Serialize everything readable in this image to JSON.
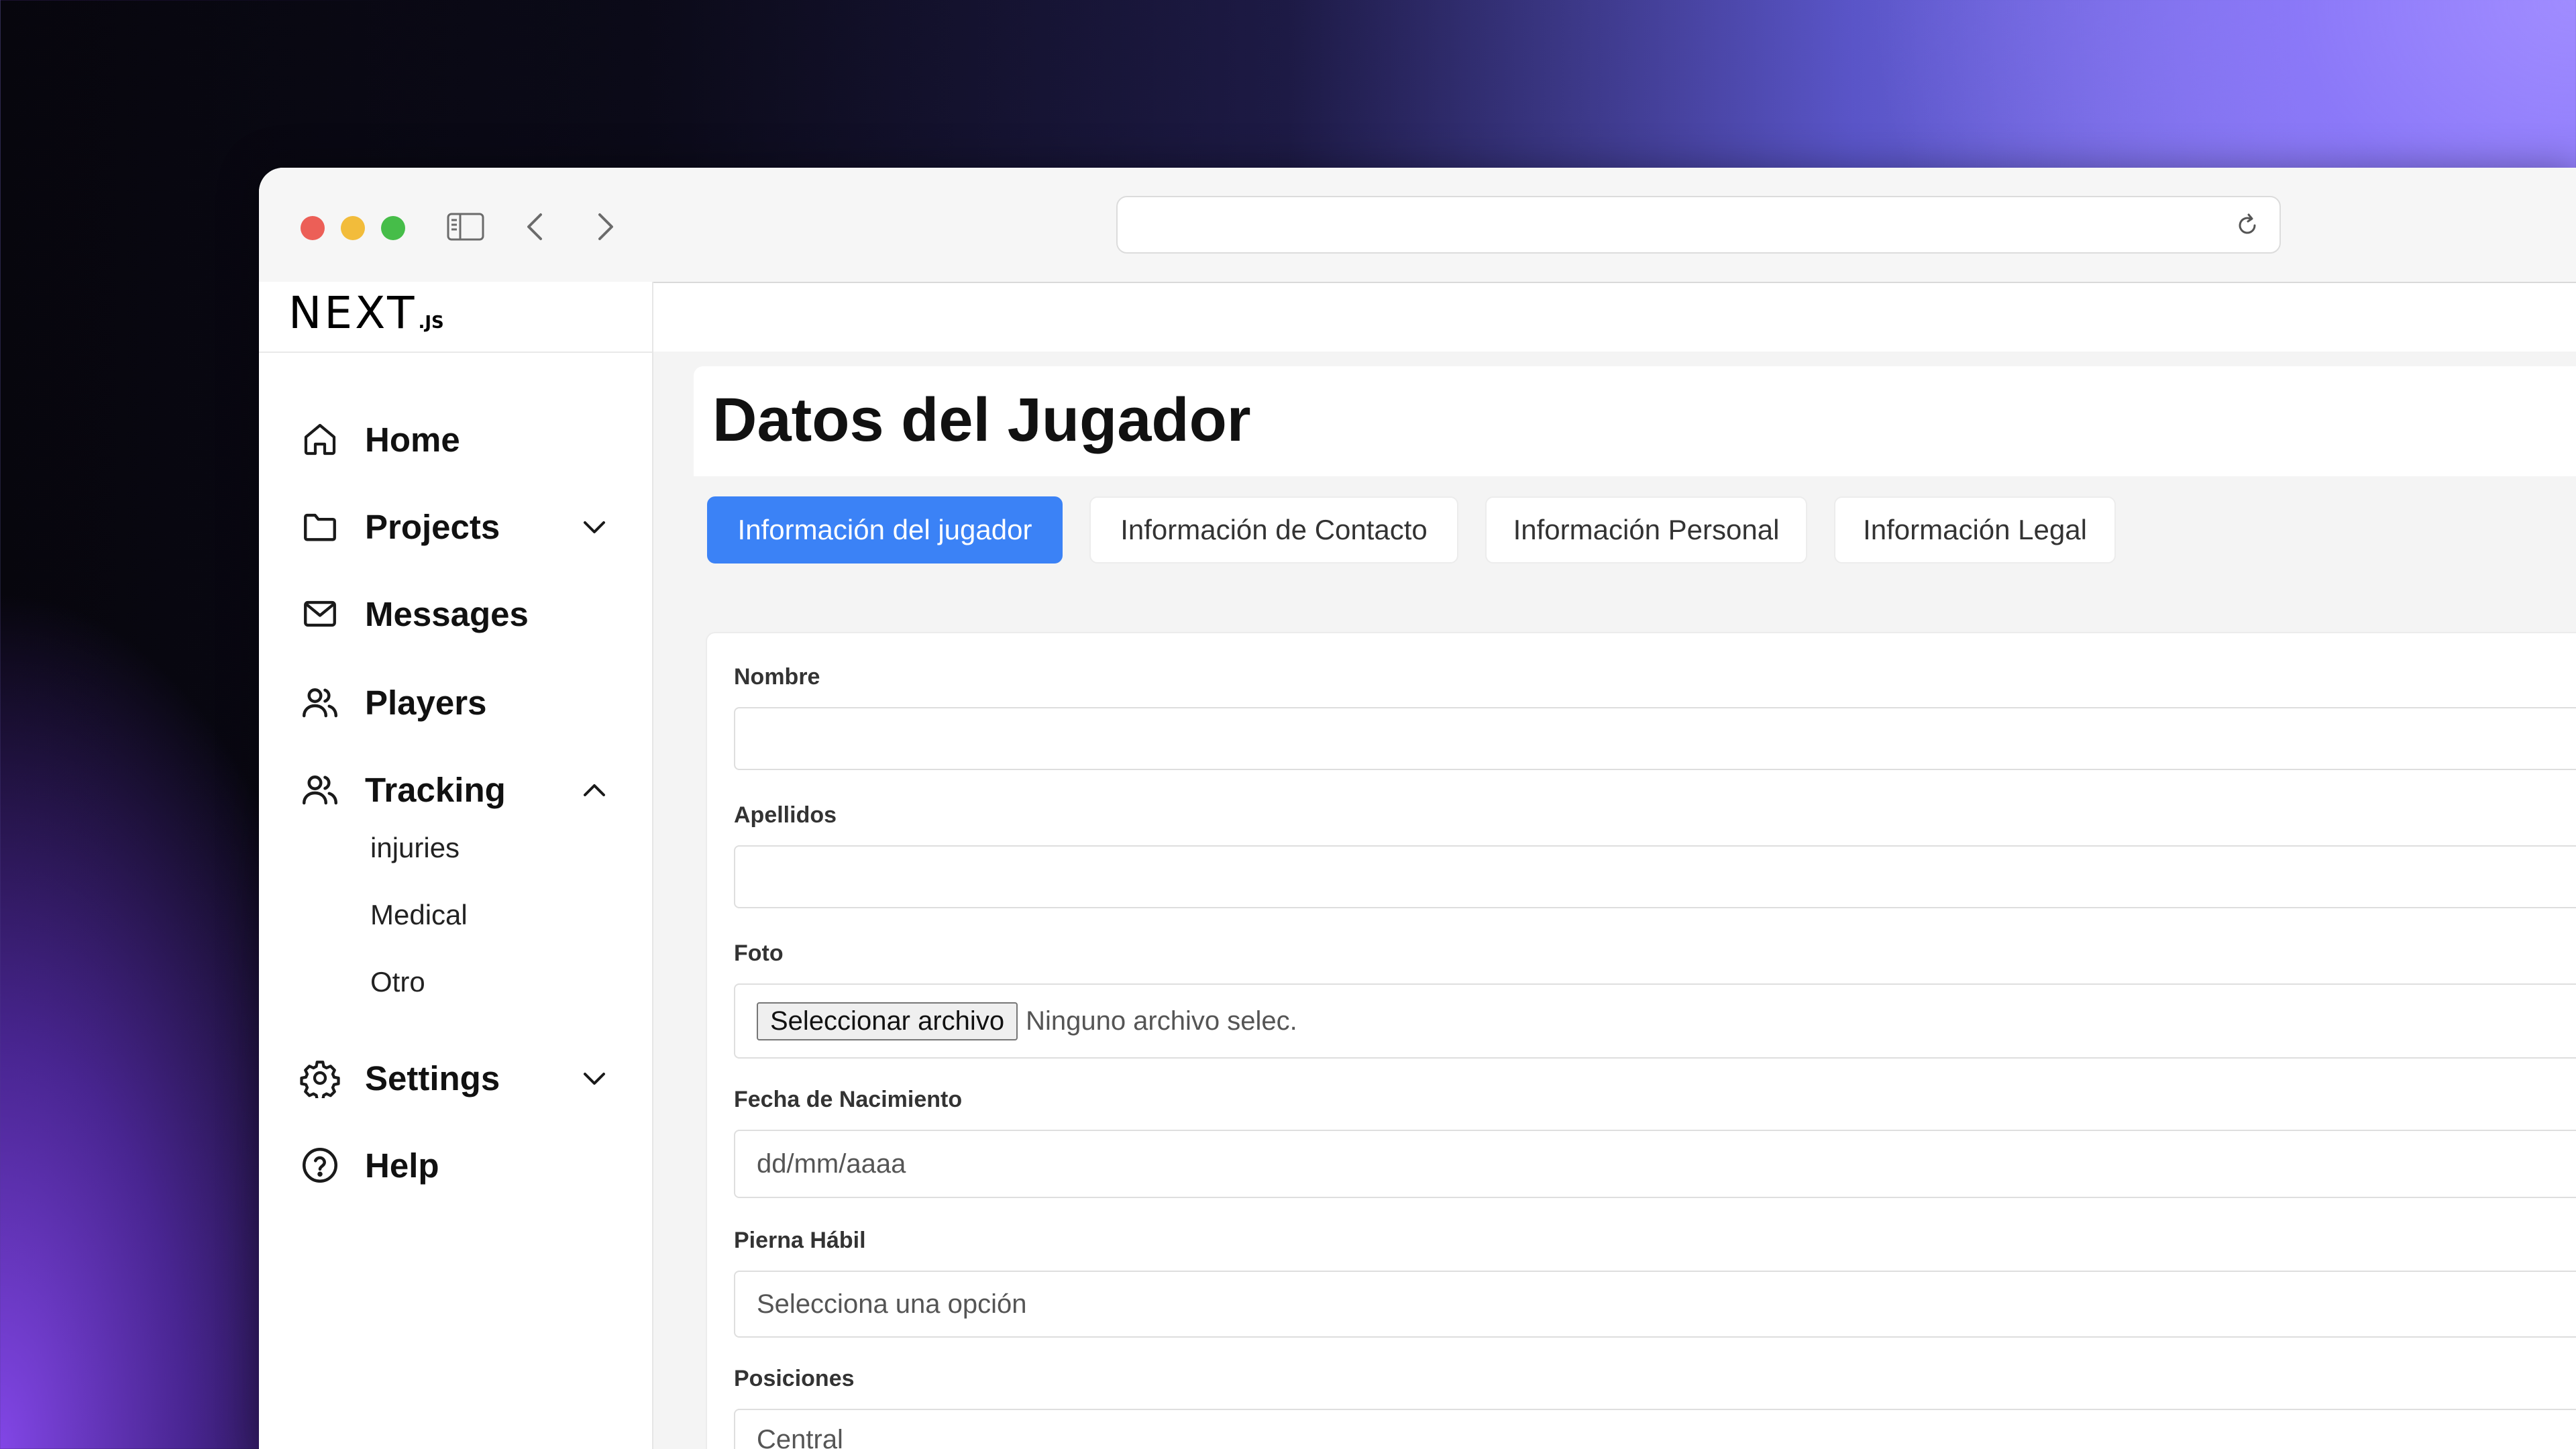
{
  "browser": {
    "url": ""
  },
  "brand": {
    "logo_main": "NEXT",
    "logo_sub": ".JS"
  },
  "sidebar": {
    "items": [
      {
        "label": "Home",
        "icon": "home-icon"
      },
      {
        "label": "Projects",
        "icon": "folder-icon",
        "chevron": "down"
      },
      {
        "label": "Messages",
        "icon": "mail-icon"
      },
      {
        "label": "Players",
        "icon": "users-icon"
      },
      {
        "label": "Tracking",
        "icon": "users-icon",
        "chevron": "up",
        "expanded": true,
        "children": [
          {
            "label": "injuries"
          },
          {
            "label": "Medical"
          },
          {
            "label": "Otro"
          }
        ]
      },
      {
        "label": "Settings",
        "icon": "gear-icon",
        "chevron": "down"
      },
      {
        "label": "Help",
        "icon": "help-circle-icon"
      }
    ]
  },
  "main": {
    "title": "Datos del Jugador",
    "tabs": [
      {
        "label": "Información del jugador",
        "active": true
      },
      {
        "label": "Información de Contacto",
        "active": false
      },
      {
        "label": "Información Personal",
        "active": false
      },
      {
        "label": "Información Legal",
        "active": false
      }
    ],
    "form": {
      "nombre": {
        "label": "Nombre",
        "value": ""
      },
      "apellidos": {
        "label": "Apellidos",
        "value": ""
      },
      "foto": {
        "label": "Foto",
        "button": "Seleccionar archivo",
        "status": "Ninguno archivo selec."
      },
      "fecha": {
        "label": "Fecha de Nacimiento",
        "placeholder": "dd/mm/aaaa"
      },
      "pierna": {
        "label": "Pierna Hábil",
        "selected": "Selecciona una opción"
      },
      "posiciones": {
        "label": "Posiciones",
        "selected": "Central"
      }
    }
  },
  "colors": {
    "accent": "#3b82f6",
    "traffic_red": "#ec5f57",
    "traffic_yellow": "#f2bc3b",
    "traffic_green": "#46bd49"
  }
}
